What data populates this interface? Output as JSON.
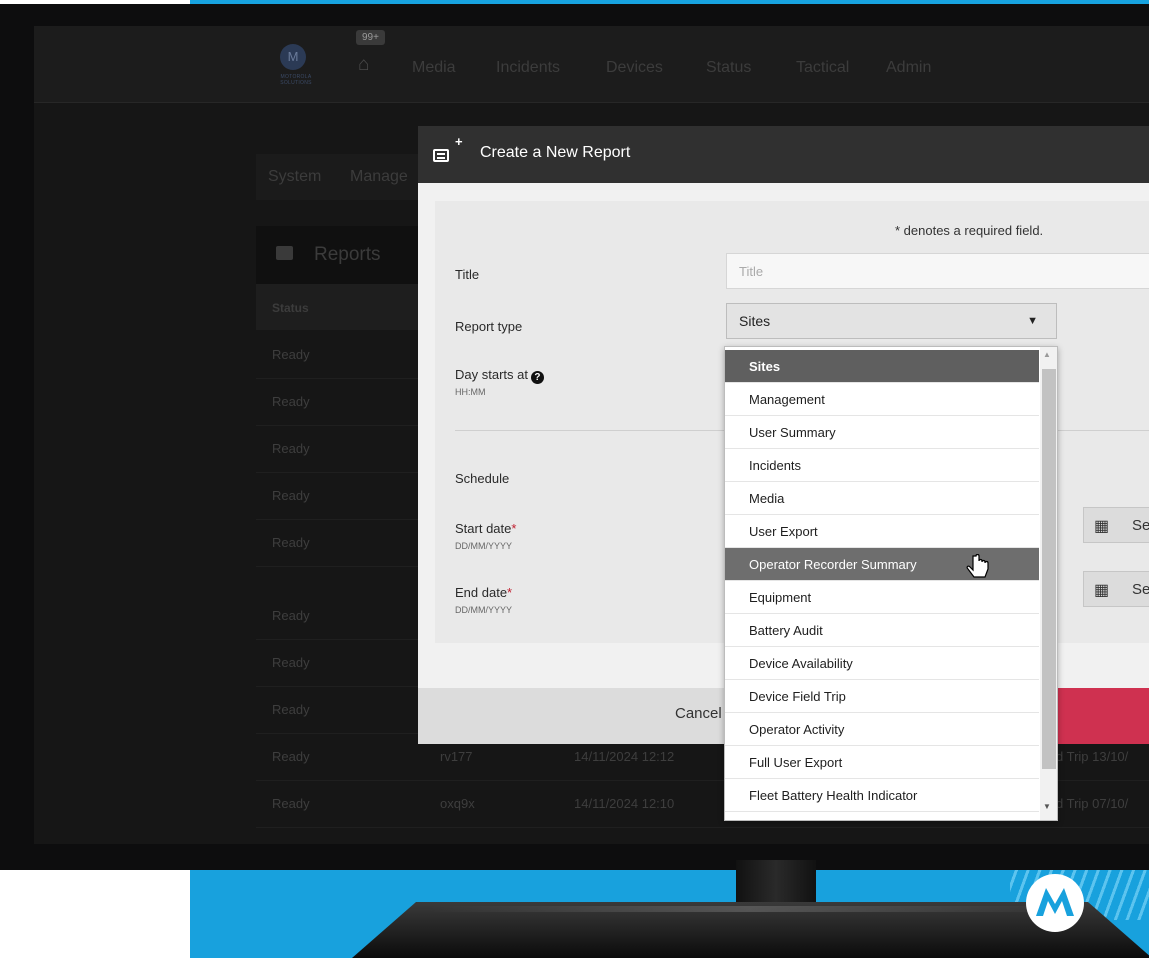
{
  "app": {
    "notifications_badge": "99+",
    "logo_text": "MOTOROLA SOLUTIONS",
    "nav": [
      "Media",
      "Incidents",
      "Devices",
      "Status",
      "Tactical",
      "Admin"
    ]
  },
  "breadcrumb": [
    "System",
    "Manage"
  ],
  "reports": {
    "title": "Reports",
    "status_header": "Status",
    "rows": [
      {
        "status": "Ready"
      },
      {
        "status": "Ready"
      },
      {
        "status": "Ready"
      },
      {
        "status": "Ready"
      },
      {
        "status": "Ready"
      },
      {
        "status": "Ready"
      },
      {
        "status": "Ready"
      },
      {
        "status": "Ready"
      },
      {
        "status": "Ready",
        "id": "rv177",
        "date": "14/11/2024 12:12",
        "name": "d Trip 13/10/"
      },
      {
        "status": "Ready",
        "id": "oxq9x",
        "date": "14/11/2024 12:10",
        "name": "d Trip 07/10/"
      }
    ]
  },
  "modal": {
    "title": "Create a New Report",
    "required_note": "* denotes a required field.",
    "fields": {
      "title_label": "Title",
      "title_placeholder": "Title",
      "report_type_label": "Report type",
      "report_type_value": "Sites",
      "day_starts_label": "Day starts at",
      "day_starts_hint": "HH:MM",
      "schedule_label": "Schedule",
      "start_date_label": "Start date",
      "start_date_hint": "DD/MM/YYYY",
      "end_date_label": "End date",
      "end_date_hint": "DD/MM/YYYY",
      "required_star": "*",
      "date_select_label": "Se"
    },
    "cancel_label": "Cancel"
  },
  "dropdown": {
    "selected": "Sites",
    "hovered": "Operator Recorder Summary",
    "options": [
      "Sites",
      "Management",
      "User Summary",
      "Incidents",
      "Media",
      "User Export",
      "Operator Recorder Summary",
      "Equipment",
      "Battery Audit",
      "Device Availability",
      "Device Field Trip",
      "Operator Activity",
      "Full User Export",
      "Fleet Battery Health Indicator"
    ]
  },
  "colors": {
    "brand_blue": "#17a3e0",
    "primary_button": "#cf3150",
    "modal_header": "#303030",
    "selected_option": "#5f5f5f"
  }
}
